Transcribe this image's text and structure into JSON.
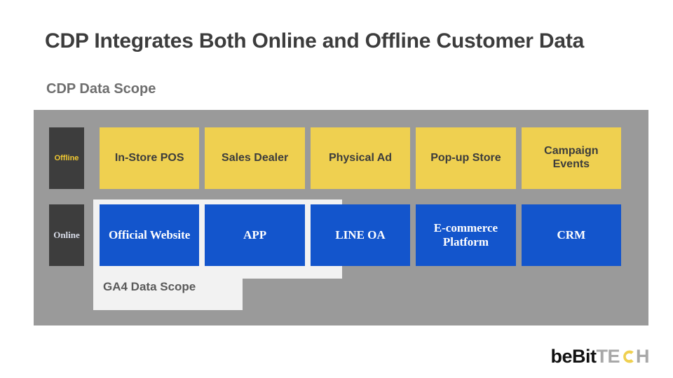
{
  "slide": {
    "title": "CDP Integrates Both Online and Offline Customer Data",
    "subtitle": "CDP Data Scope"
  },
  "diagram": {
    "ga4_scope_label": "GA4 Data Scope",
    "rows": [
      {
        "id": "offline",
        "label": "Offline",
        "boxes": [
          "In-Store POS",
          "Sales Dealer",
          "Physical Ad",
          "Pop-up Store",
          "Campaign Events"
        ]
      },
      {
        "id": "online",
        "label": "Online",
        "boxes": [
          "Official Website",
          "APP",
          "LINE OA",
          "E-commerce Platform",
          "CRM"
        ]
      }
    ]
  },
  "logo": {
    "primary": "beBit",
    "secondary_prefix": "TE",
    "secondary_icon": "c-letter-ring-icon",
    "secondary_suffix": "H"
  },
  "colors": {
    "panel_gray": "#9A9A9A",
    "offline_yellow": "#EFD050",
    "online_blue": "#1355CC",
    "row_label_dark": "#3D3D3D",
    "ga4_panel_white": "#F2F2F2",
    "title_gray": "#3C3C3C",
    "subtitle_gray": "#6E6E6E",
    "logo_yellow": "#EFD050"
  }
}
